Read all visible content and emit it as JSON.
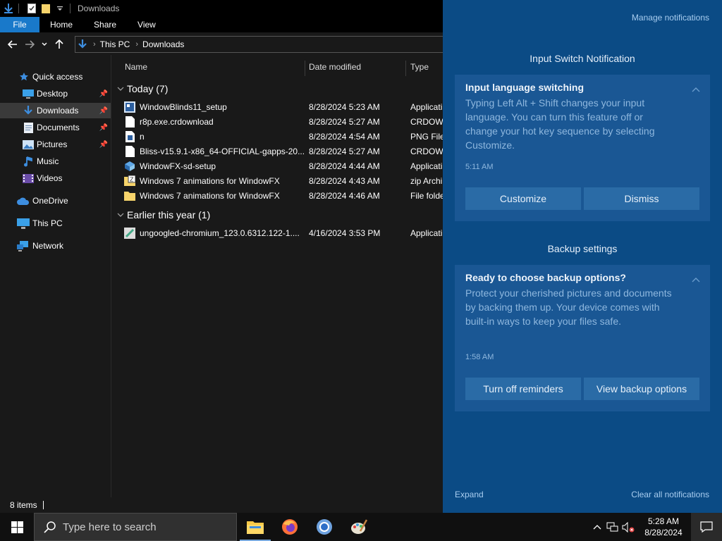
{
  "explorer": {
    "title": "Downloads",
    "ribbon_tabs": [
      "File",
      "Home",
      "Share",
      "View"
    ],
    "address": {
      "crumbs": [
        "This PC",
        "Downloads"
      ]
    },
    "nav": {
      "quick_access": "Quick access",
      "items": [
        {
          "label": "Desktop",
          "pinned": true
        },
        {
          "label": "Downloads",
          "pinned": true
        },
        {
          "label": "Documents",
          "pinned": true
        },
        {
          "label": "Pictures",
          "pinned": true
        },
        {
          "label": "Music",
          "pinned": false
        },
        {
          "label": "Videos",
          "pinned": false
        }
      ],
      "onedrive": "OneDrive",
      "this_pc": "This PC",
      "network": "Network"
    },
    "columns": {
      "name": "Name",
      "date": "Date modified",
      "type": "Type"
    },
    "groups": [
      {
        "label": "Today (7)",
        "files": [
          {
            "name": "WindowBlinds11_setup",
            "date": "8/28/2024 5:23 AM",
            "type": "Applicati",
            "icon": "setup-icon"
          },
          {
            "name": "r8p.exe.crdownload",
            "date": "8/28/2024 5:27 AM",
            "type": "CRDOWN",
            "icon": "file-icon"
          },
          {
            "name": "n",
            "date": "8/28/2024 4:54 AM",
            "type": "PNG File",
            "icon": "image-icon"
          },
          {
            "name": "Bliss-v15.9.1-x86_64-OFFICIAL-gapps-20...",
            "date": "8/28/2024 5:27 AM",
            "type": "CRDOWN",
            "icon": "file-icon"
          },
          {
            "name": "WindowFX-sd-setup",
            "date": "8/28/2024 4:44 AM",
            "type": "Applicati",
            "icon": "installer-icon"
          },
          {
            "name": "Windows 7 animations for WindowFX",
            "date": "8/28/2024 4:43 AM",
            "type": "zip Archi",
            "icon": "zip-icon"
          },
          {
            "name": "Windows 7 animations for WindowFX",
            "date": "8/28/2024 4:46 AM",
            "type": "File folde",
            "icon": "folder-icon"
          }
        ]
      },
      {
        "label": "Earlier this year (1)",
        "files": [
          {
            "name": "ungoogled-chromium_123.0.6312.122-1....",
            "date": "4/16/2024 3:53 PM",
            "type": "Applicati",
            "icon": "installer-icon"
          }
        ]
      }
    ],
    "status": "8 items"
  },
  "action_center": {
    "manage": "Manage notifications",
    "groups": [
      {
        "app": "Input Switch Notification",
        "title": "Input language switching",
        "body": "Typing Left Alt + Shift changes your input language. You can turn this feature off or change your hot key sequence by selecting Customize.",
        "time": "5:11 AM",
        "buttons": [
          "Customize",
          "Dismiss"
        ]
      },
      {
        "app": "Backup settings",
        "title": "Ready to choose backup options?",
        "body": "Protect your cherished pictures and documents by backing them up. Your device comes with built-in ways to keep your files safe.",
        "time": "1:58 AM",
        "buttons": [
          "Turn off reminders",
          "View backup options"
        ]
      }
    ],
    "expand": "Expand",
    "clear_all": "Clear all notifications"
  },
  "taskbar": {
    "search_placeholder": "Type here to search",
    "apps": [
      "file-explorer-icon",
      "firefox-icon",
      "chrome-icon",
      "paint-icon"
    ],
    "clock": {
      "time": "5:28 AM",
      "date": "8/28/2024"
    }
  },
  "colors": {
    "accent": "#1979ca",
    "action_center_bg": "#0b4b85",
    "card_bg": "#1a5794",
    "button_bg": "#2a6ba6"
  }
}
